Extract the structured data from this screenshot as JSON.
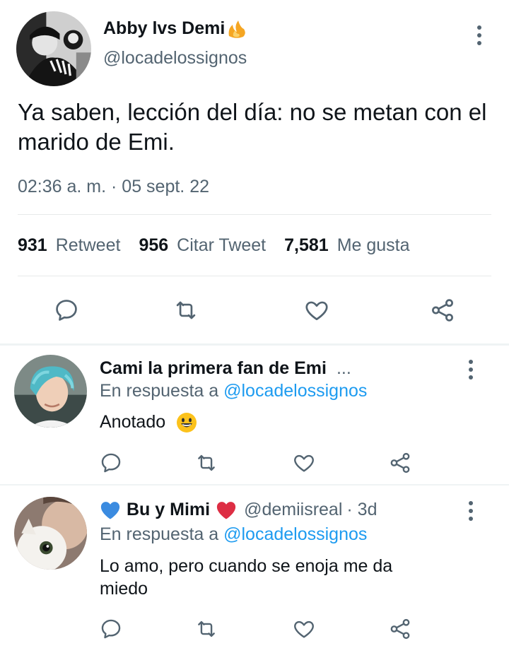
{
  "main_tweet": {
    "author_name": "Abby lvs Demi",
    "author_emoji": "flame-emoji-icon",
    "handle": "@locadelossignos",
    "text": "Ya saben, lección del día: no se metan con el marido de Emi.",
    "timestamp": "02:36 a. m. · 05 sept. 22",
    "stats": {
      "retweets_count": "931",
      "retweets_label": "Retweet",
      "quotes_count": "956",
      "quotes_label": "Citar Tweet",
      "likes_count": "7,581",
      "likes_label": "Me gusta"
    },
    "actions": [
      "reply-icon",
      "retweet-icon",
      "heart-icon",
      "share-icon"
    ]
  },
  "replies": [
    {
      "name": "Cami la primera fan de Emi",
      "truncation": "...",
      "reply_prefix": "En respuesta a ",
      "reply_to": "@locadelossignos",
      "text": "Anotado",
      "emoji": "grinning-face-icon"
    },
    {
      "name_prefix_emoji": "blue-heart-icon",
      "name": "Bu y Mimi",
      "name_suffix_emoji": "red-heart-icon",
      "handle": "@demiisreal",
      "time": "· 3d",
      "reply_prefix": "En respuesta a ",
      "reply_to": "@locadelossignos",
      "text": "Lo amo, pero cuando se enoja me da miedo"
    }
  ],
  "colors": {
    "text_primary": "#0f1419",
    "text_secondary": "#536471",
    "link": "#1d9bf0",
    "divider": "#e7e9ea"
  }
}
